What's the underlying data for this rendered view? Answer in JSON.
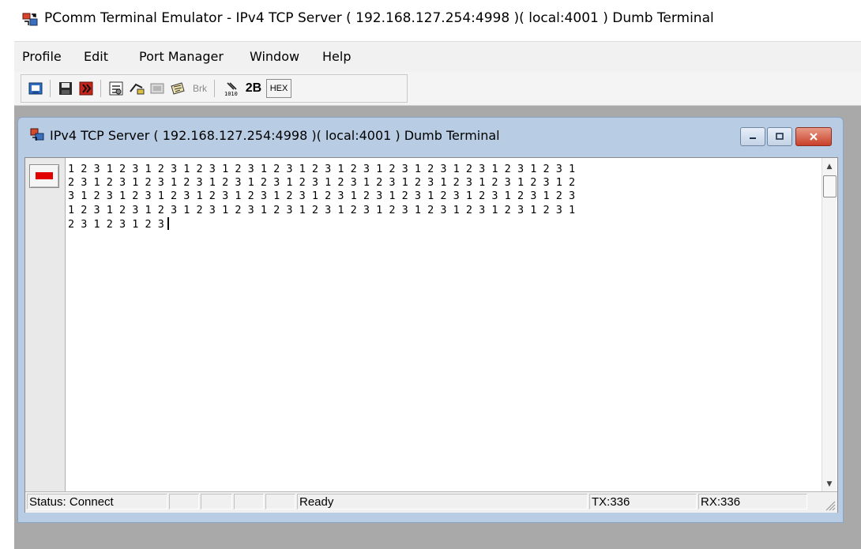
{
  "app": {
    "title": "PComm Terminal Emulator - IPv4 TCP Server ( 192.168.127.254:4998 )( local:4001 ) Dumb Terminal"
  },
  "menu": {
    "items": [
      "Profile",
      "Edit",
      "Port Manager",
      "Window",
      "Help"
    ]
  },
  "toolbar": {
    "buttons": [
      {
        "icon": "open-profile-icon"
      },
      {
        "icon": "save-icon"
      },
      {
        "icon": "exit-icon"
      },
      {
        "icon": "settings-icon"
      },
      {
        "icon": "transfer-icon"
      },
      {
        "icon": "capture-icon"
      },
      {
        "icon": "script-icon"
      },
      {
        "label": "Brk",
        "icon": "break-icon"
      },
      {
        "icon": "hex-mode-icon"
      },
      {
        "label": "2B",
        "icon": "two-byte-icon"
      },
      {
        "label": "HEX",
        "icon": "hex-icon"
      }
    ]
  },
  "child_window": {
    "title": "IPv4 TCP Server ( 192.168.127.254:4998 )( local:4001 ) Dumb Terminal",
    "controls": [
      "minimize-icon",
      "restore-icon",
      "close-icon"
    ]
  },
  "terminal": {
    "lines": [
      "1 2 3 1 2 3 1 2 3 1 2 3 1 2 3 1 2 3 1 2 3 1 2 3 1 2 3 1 2 3 1 2 3 1 2 3 1 2 3 1",
      "2 3 1 2 3 1 2 3 1 2 3 1 2 3 1 2 3 1 2 3 1 2 3 1 2 3 1 2 3 1 2 3 1 2 3 1 2 3 1 2",
      "3 1 2 3 1 2 3 1 2 3 1 2 3 1 2 3 1 2 3 1 2 3 1 2 3 1 2 3 1 2 3 1 2 3 1 2 3 1 2 3",
      "1 2 3 1 2 3 1 2 3 1 2 3 1 2 3 1 2 3 1 2 3 1 2 3 1 2 3 1 2 3 1 2 3 1 2 3 1 2 3 1",
      "2 3 1 2 3 1 2 3"
    ]
  },
  "status": {
    "status_text": "Status: Connect",
    "ready": "Ready",
    "tx": "TX:336",
    "rx": "RX:336"
  },
  "colors": {
    "led": "#e00000",
    "child_title_bg": "#b8cde3",
    "mdi_bg": "#a9a9a9"
  }
}
